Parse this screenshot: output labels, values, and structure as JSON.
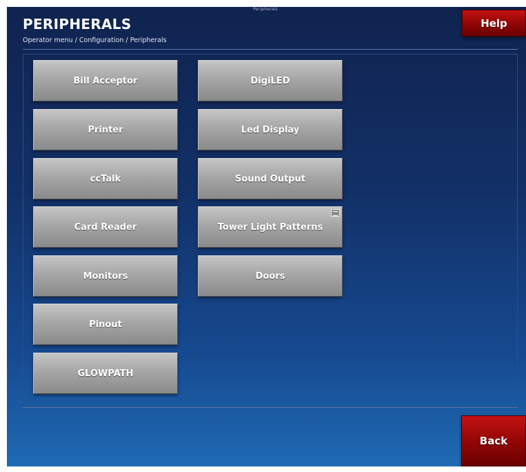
{
  "header": {
    "caption": "Peripherals",
    "title": "PERIPHERALS",
    "breadcrumb": "Operator menu / Configuration / Peripherals",
    "help_label": "Help"
  },
  "buttons": {
    "bill_acceptor": "Bill Acceptor",
    "printer": "Printer",
    "cctalk": "ccTalk",
    "card_reader": "Card Reader",
    "monitors": "Monitors",
    "pinout": "Pinout",
    "glowpath": "GLOWPATH",
    "digiled": "DigiLED",
    "led_display": "Led Display",
    "sound_output": "Sound Output",
    "tower_light_patterns": "Tower Light Patterns",
    "doors": "Doors"
  },
  "footer": {
    "back_label": "Back"
  },
  "icons": {
    "tower_light_patterns_corner": "window-corner-icon"
  },
  "colors": {
    "accent_red": "#8f0505",
    "button_gray": "#a6a6a6",
    "background_blue": "#123067"
  }
}
